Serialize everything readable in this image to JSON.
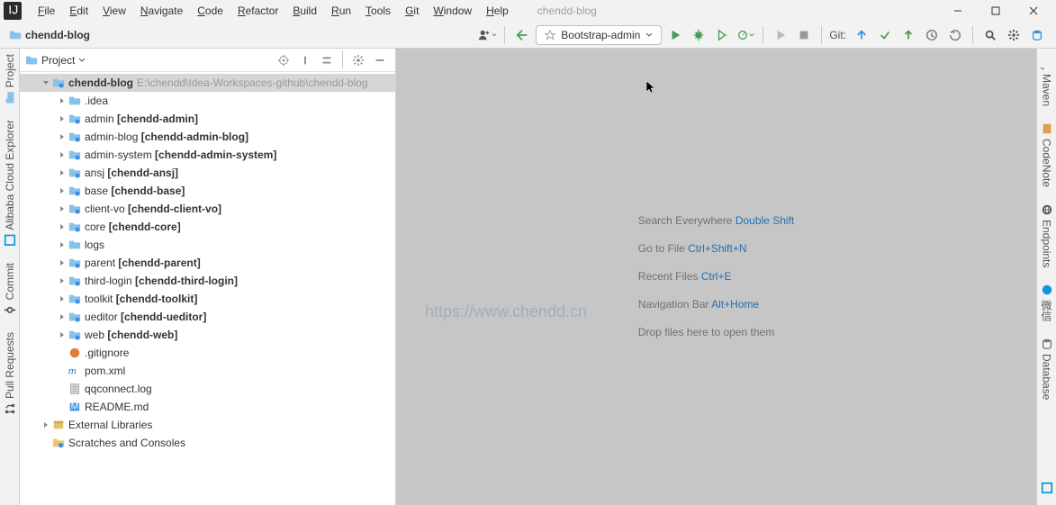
{
  "window": {
    "title": "chendd-blog"
  },
  "menu": [
    "File",
    "Edit",
    "View",
    "Navigate",
    "Code",
    "Refactor",
    "Build",
    "Run",
    "Tools",
    "Git",
    "Window",
    "Help"
  ],
  "breadcrumb": {
    "root": "chendd-blog"
  },
  "toolbar": {
    "run_config": "Bootstrap-admin",
    "git_label": "Git:"
  },
  "pane": {
    "title": "Project"
  },
  "tree": {
    "root": {
      "name": "chendd-blog",
      "path": "E:\\chendd\\Idea-Workspaces-github\\chendd-blog"
    },
    "children": [
      {
        "name": ".idea",
        "type": "dir"
      },
      {
        "name": "admin",
        "boxed": "[chendd-admin]",
        "type": "mod"
      },
      {
        "name": "admin-blog",
        "boxed": "[chendd-admin-blog]",
        "type": "mod"
      },
      {
        "name": "admin-system",
        "boxed": "[chendd-admin-system]",
        "type": "mod"
      },
      {
        "name": "ansj",
        "boxed": "[chendd-ansj]",
        "type": "mod"
      },
      {
        "name": "base",
        "boxed": "[chendd-base]",
        "type": "mod"
      },
      {
        "name": "client-vo",
        "boxed": "[chendd-client-vo]",
        "type": "mod"
      },
      {
        "name": "core",
        "boxed": "[chendd-core]",
        "type": "mod"
      },
      {
        "name": "logs",
        "type": "dir"
      },
      {
        "name": "parent",
        "boxed": "[chendd-parent]",
        "type": "mod"
      },
      {
        "name": "third-login",
        "boxed": "[chendd-third-login]",
        "type": "mod"
      },
      {
        "name": "toolkit",
        "boxed": "[chendd-toolkit]",
        "type": "mod"
      },
      {
        "name": "ueditor",
        "boxed": "[chendd-ueditor]",
        "type": "mod"
      },
      {
        "name": "web",
        "boxed": "[chendd-web]",
        "type": "mod"
      },
      {
        "name": ".gitignore",
        "type": "file-git"
      },
      {
        "name": "pom.xml",
        "type": "file-pom"
      },
      {
        "name": "qqconnect.log",
        "type": "file-txt"
      },
      {
        "name": "README.md",
        "type": "file-md"
      }
    ],
    "external": "External Libraries",
    "scratches": "Scratches and Consoles"
  },
  "editor_tips": [
    {
      "label": "Search Everywhere",
      "kbd": "Double Shift"
    },
    {
      "label": "Go to File",
      "kbd": "Ctrl+Shift+N"
    },
    {
      "label": "Recent Files",
      "kbd": "Ctrl+E"
    },
    {
      "label": "Navigation Bar",
      "kbd": "Alt+Home"
    },
    {
      "label": "Drop files here to open them",
      "kbd": ""
    }
  ],
  "watermark": "https://www.chendd.cn",
  "left_gutter": [
    "Project",
    "Alibaba Cloud Explorer",
    "Commit",
    "Pull Requests"
  ],
  "right_gutter": [
    "Maven",
    "CodeNote",
    "Endpoints",
    "微信",
    "Database"
  ]
}
